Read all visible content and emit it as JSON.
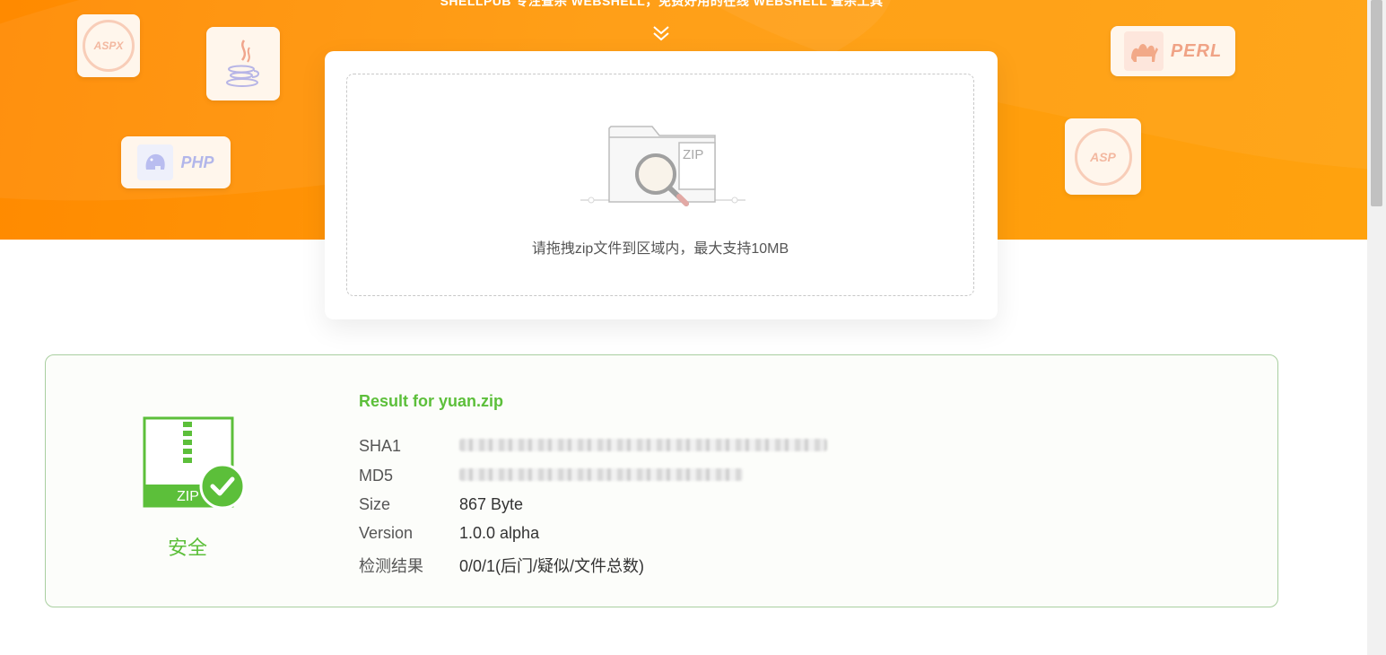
{
  "hero": {
    "tagline": "SHELLPUB 专注查杀 WEBSHELL，免费好用的在线 WEBSHELL 查杀工具",
    "badges": {
      "aspx": "ASPX",
      "php": "PHP",
      "perl": "PERL",
      "asp": "ASP"
    }
  },
  "upload": {
    "zip_label": "ZIP",
    "instruction": "请拖拽zip文件到区域内，最大支持10MB"
  },
  "result": {
    "title": "Result for yuan.zip",
    "status": "安全",
    "zip_label": "ZIP",
    "rows": [
      {
        "key": "SHA1",
        "value": ""
      },
      {
        "key": "MD5",
        "value": ""
      },
      {
        "key": "Size",
        "value": "867 Byte"
      },
      {
        "key": "Version",
        "value": "1.0.0 alpha"
      },
      {
        "key": "检测结果",
        "value": "0/0/1(后门/疑似/文件总数)"
      }
    ]
  },
  "colors": {
    "hero_orange": "#ff9200",
    "safe_green": "#5cbf3a",
    "border_green": "#a9cfa0"
  }
}
